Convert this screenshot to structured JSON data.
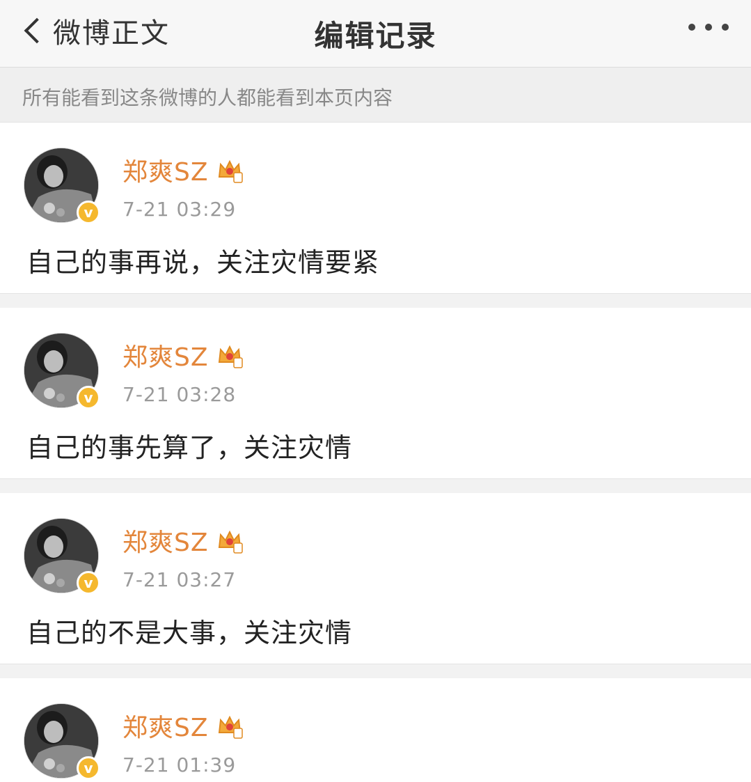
{
  "nav": {
    "back_label": "微博正文",
    "title": "编辑记录"
  },
  "notice": "所有能看到这条微博的人都能看到本页内容",
  "posts": [
    {
      "user": "郑爽SZ",
      "time": "7-21 03:29",
      "text": "自己的事再说，关注灾情要紧"
    },
    {
      "user": "郑爽SZ",
      "time": "7-21 03:28",
      "text": "自己的事先算了，关注灾情"
    },
    {
      "user": "郑爽SZ",
      "time": "7-21 03:27",
      "text": "自己的不是大事，关注灾情"
    },
    {
      "user": "郑爽SZ",
      "time": "7-21 01:39",
      "text": ""
    }
  ],
  "icons": {
    "back": "chevron-left-icon",
    "more": "more-dots-icon",
    "verified": "verified-v-icon",
    "member": "crown-icon"
  },
  "colors": {
    "username": "#e3863b",
    "verified": "#f5b82e",
    "muted": "#9a9a9a"
  }
}
